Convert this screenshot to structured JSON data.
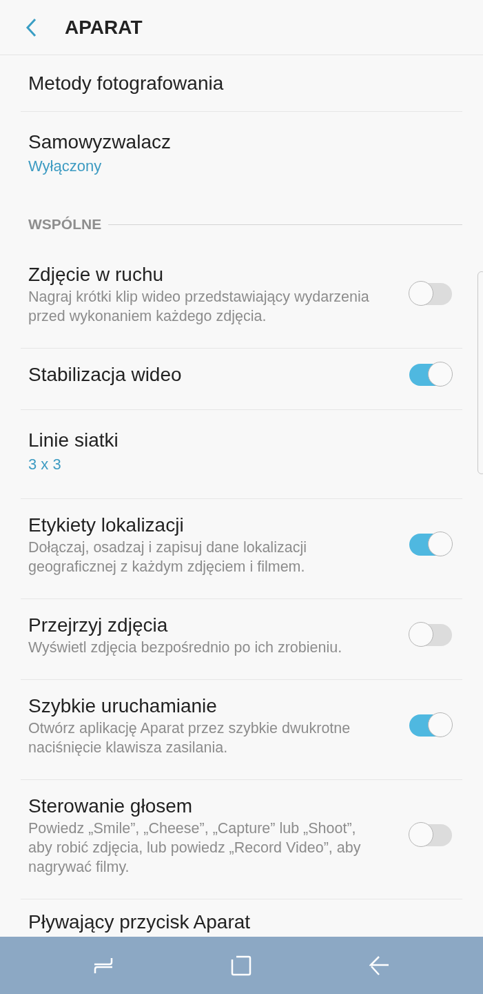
{
  "header": {
    "title": "APARAT"
  },
  "items": [
    {
      "kind": "plain",
      "title": "Metody fotografowania"
    },
    {
      "kind": "value",
      "title": "Samowyzwalacz",
      "value": "Wyłączony"
    },
    {
      "kind": "section",
      "title": "WSPÓLNE"
    },
    {
      "kind": "toggle",
      "title": "Zdjęcie w ruchu",
      "subtitle": "Nagraj krótki klip wideo przedstawiający wydarzenia przed wykonaniem każdego zdjęcia.",
      "on": false
    },
    {
      "kind": "toggle",
      "title": "Stabilizacja wideo",
      "on": true
    },
    {
      "kind": "value",
      "title": "Linie siatki",
      "value": "3 x 3"
    },
    {
      "kind": "toggle",
      "title": "Etykiety lokalizacji",
      "subtitle": "Dołączaj, osadzaj i zapisuj dane lokalizacji geograficznej z każdym zdjęciem i filmem.",
      "on": true
    },
    {
      "kind": "toggle",
      "title": "Przejrzyj zdjęcia",
      "subtitle": "Wyświetl zdjęcia bezpośrednio po ich zrobieniu.",
      "on": false
    },
    {
      "kind": "toggle",
      "title": "Szybkie uruchamianie",
      "subtitle": "Otwórz aplikację Aparat przez szybkie dwukrotne naciśnięcie klawisza zasilania.",
      "on": true
    },
    {
      "kind": "toggle",
      "title": "Sterowanie głosem",
      "subtitle": "Powiedz „Smile”, „Cheese”, „Capture” lub „Shoot”, aby robić zdjęcia, lub powiedz „Record Video”, aby nagrywać filmy.",
      "on": false
    },
    {
      "kind": "plain",
      "title": "Pływający przycisk Aparat"
    }
  ]
}
